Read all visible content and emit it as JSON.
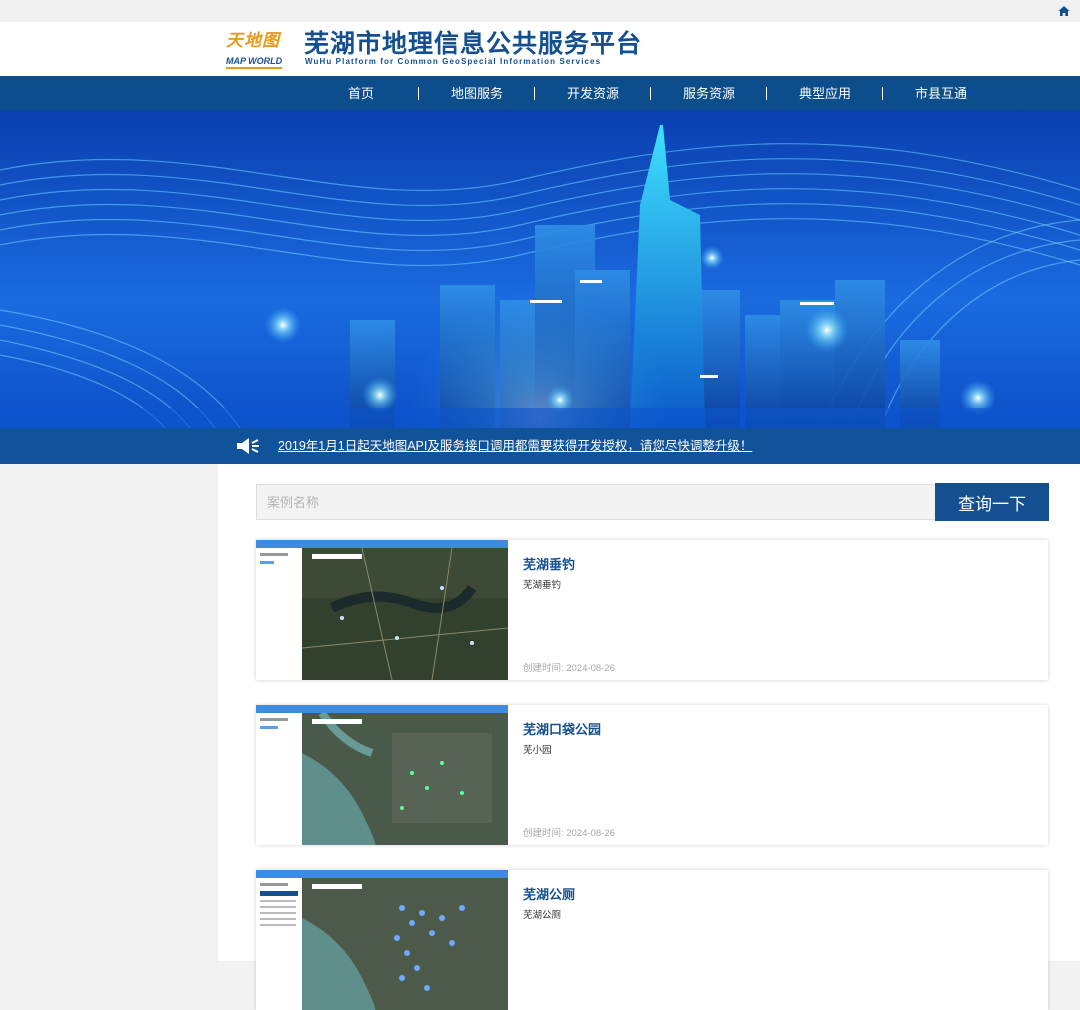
{
  "site": {
    "logo_cn": "天地图",
    "logo_en": "MAP WORLD",
    "title": "芜湖市地理信息公共服务平台",
    "subtitle": "WuHu Platform for Common GeoSpecial Information Services"
  },
  "nav": {
    "items": [
      {
        "label": "首页"
      },
      {
        "label": "地图服务"
      },
      {
        "label": "开发资源"
      },
      {
        "label": "服务资源"
      },
      {
        "label": "典型应用"
      },
      {
        "label": "市县互通"
      }
    ]
  },
  "notice": {
    "text": "2019年1月1日起天地图API及服务接口调用都需要获得开发授权，请您尽快调整升级！"
  },
  "search": {
    "placeholder": "案例名称",
    "value": "",
    "button_label": "查询一下"
  },
  "cases": [
    {
      "title": "芜湖垂钓",
      "desc": "芜湖垂钓",
      "time": "创建时间: 2024-08-26"
    },
    {
      "title": "芜湖口袋公园",
      "desc": "芜小园",
      "time": "创建时间: 2024-08-26"
    },
    {
      "title": "芜湖公厕",
      "desc": "芜湖公厕",
      "time": ""
    }
  ],
  "colors": {
    "brand_blue": "#14508f",
    "nav_blue": "#0c4d8c",
    "notice_blue": "#11539a",
    "logo_orange": "#e89a1c"
  },
  "icons": [
    "home-icon",
    "megaphone-icon"
  ]
}
